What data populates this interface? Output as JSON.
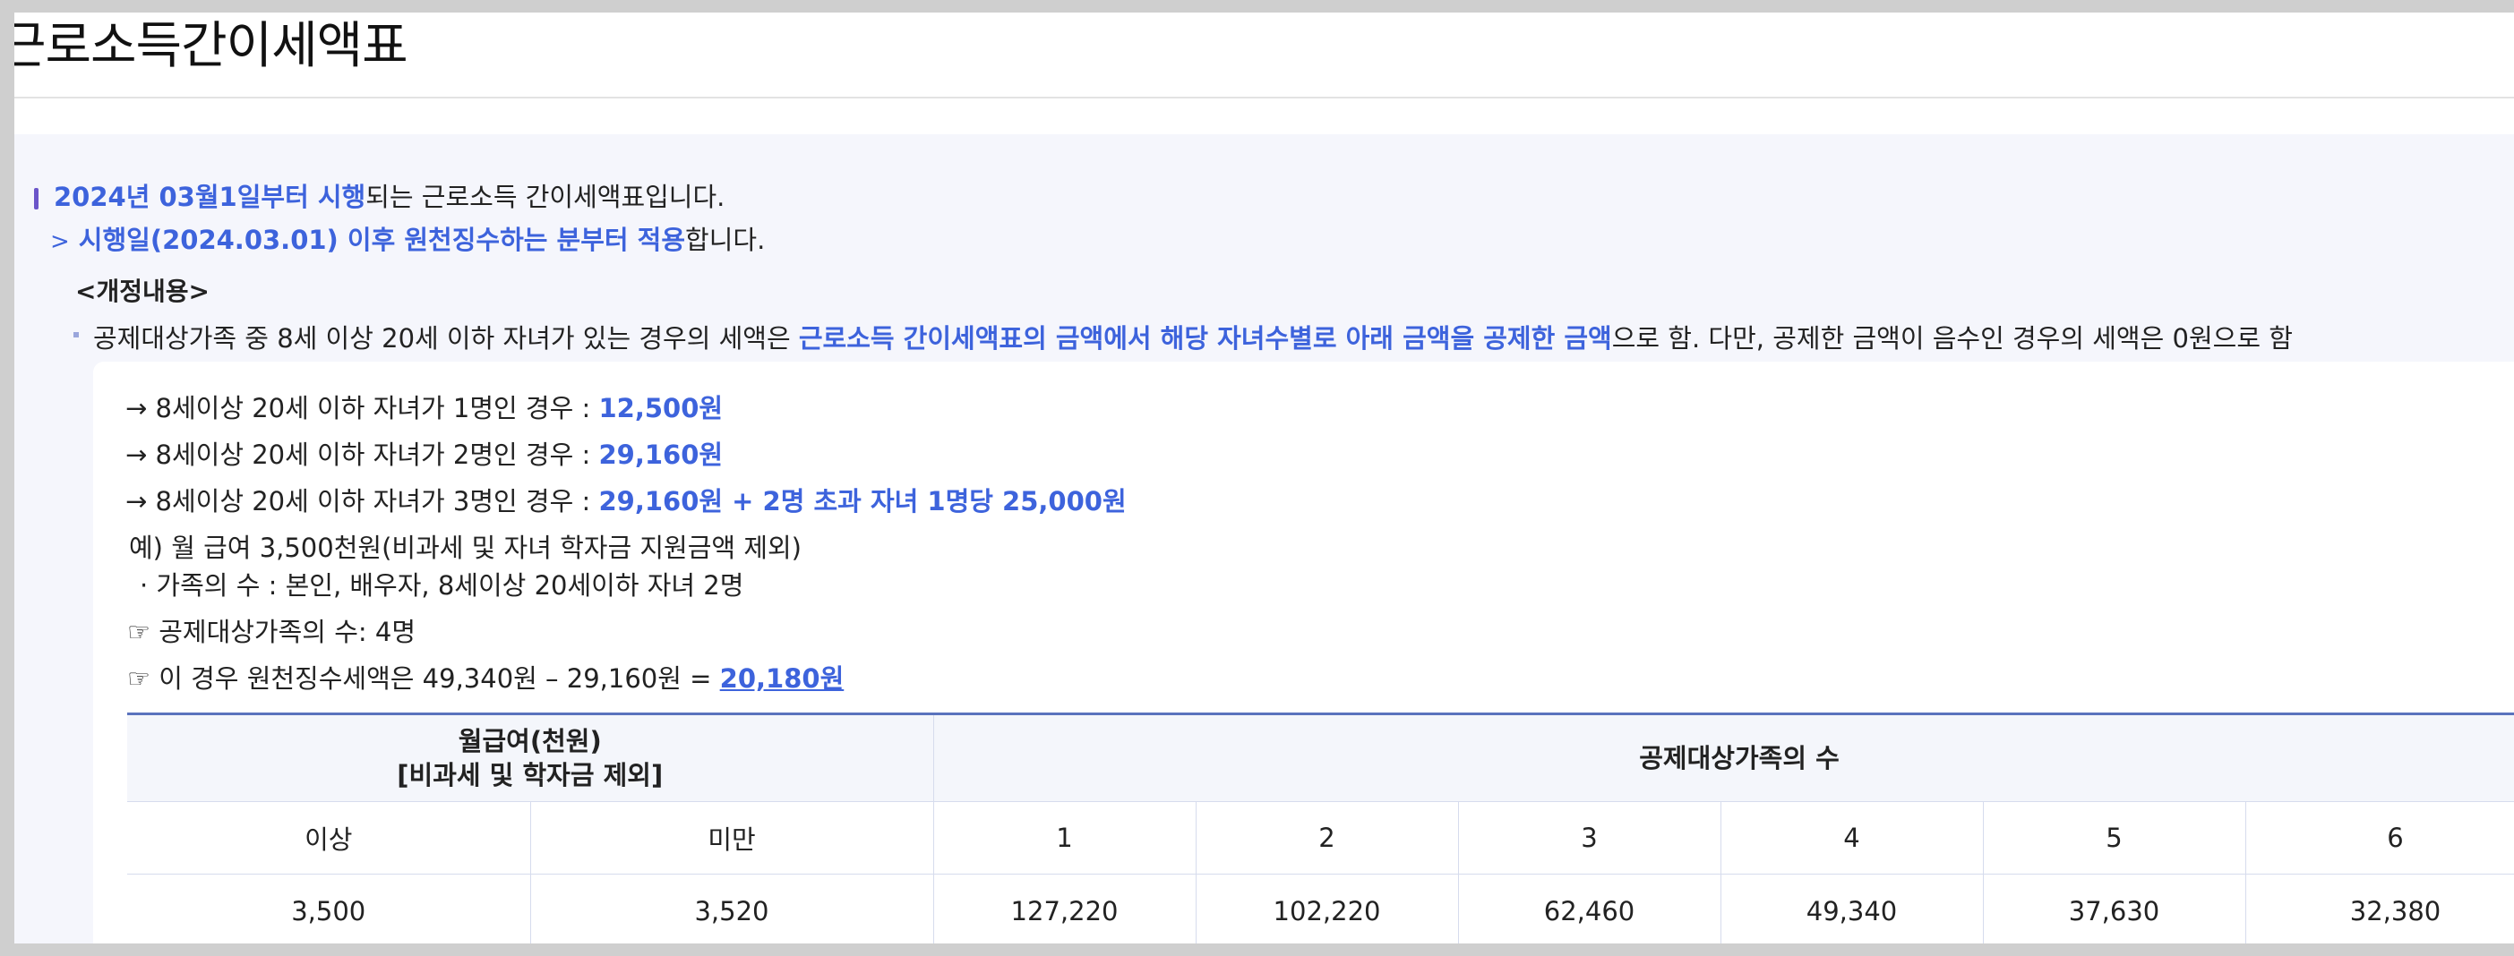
{
  "page": {
    "title": "근로소득간이세액표"
  },
  "notice": {
    "line1_highlight": "2024년 03월1일부터 시행",
    "line1_rest": "되는 근로소득 간이세액표입니다.",
    "line2_highlight": "시행일(2024.03.01) 이후 원천징수하는 분부터 적용",
    "line2_rest": "합니다.",
    "chevron": ">",
    "revision_heading": "<개정내용>",
    "revision_text_a": "공제대상가족 중 8세 이상 20세 이하 자녀가 있는 경우의 세액은 ",
    "revision_text_highlight": "근로소득 간이세액표의 금액에서 해당 자녀수별로 아래 금액을 공제한 금액",
    "revision_text_b": "으로 함. 다만, 공제한 금액이 음수인 경우의 세액은 0원으로 함"
  },
  "deductions": [
    {
      "label": "→ 8세이상 20세 이하 자녀가 1명인 경우 : ",
      "amount": "12,500원"
    },
    {
      "label": "→ 8세이상 20세 이하 자녀가 2명인 경우 : ",
      "amount": "29,160원"
    },
    {
      "label": "→ 8세이상 20세 이하 자녀가 3명인 경우 : ",
      "amount": "29,160원 + 2명 초과 자녀 1명당 25,000원"
    }
  ],
  "example": {
    "line1": "예) 월 급여 3,500천원(비과세 및 자녀 학자금 지원금액 제외)",
    "line2": "· 가족의 수 : 본인, 배우자, 8세이상 20세이하 자녀 2명",
    "line3": "☞ 공제대상가족의 수: 4명",
    "line4_text": "☞ 이 경우 원천징수세액은 49,340원 – 29,160원 = ",
    "line4_result": "20,180원"
  },
  "table": {
    "head_salary_line1": "월급여(천원)",
    "head_salary_line2": "[비과세 및 학자금 제외]",
    "head_family": "공제대상가족의 수",
    "sub_from": "이상",
    "sub_to": "미만",
    "family_counts": [
      "1",
      "2",
      "3",
      "4",
      "5",
      "6"
    ],
    "row": {
      "from": "3,500",
      "to": "3,520",
      "values": [
        "127,220",
        "102,220",
        "62,460",
        "49,340",
        "37,630",
        "32,380"
      ]
    }
  },
  "colors": {
    "accent": "#3d63dc",
    "notice_bg": "#f5f6fc",
    "table_border": "#d6dced",
    "table_head_bg": "#f4f6fb"
  }
}
